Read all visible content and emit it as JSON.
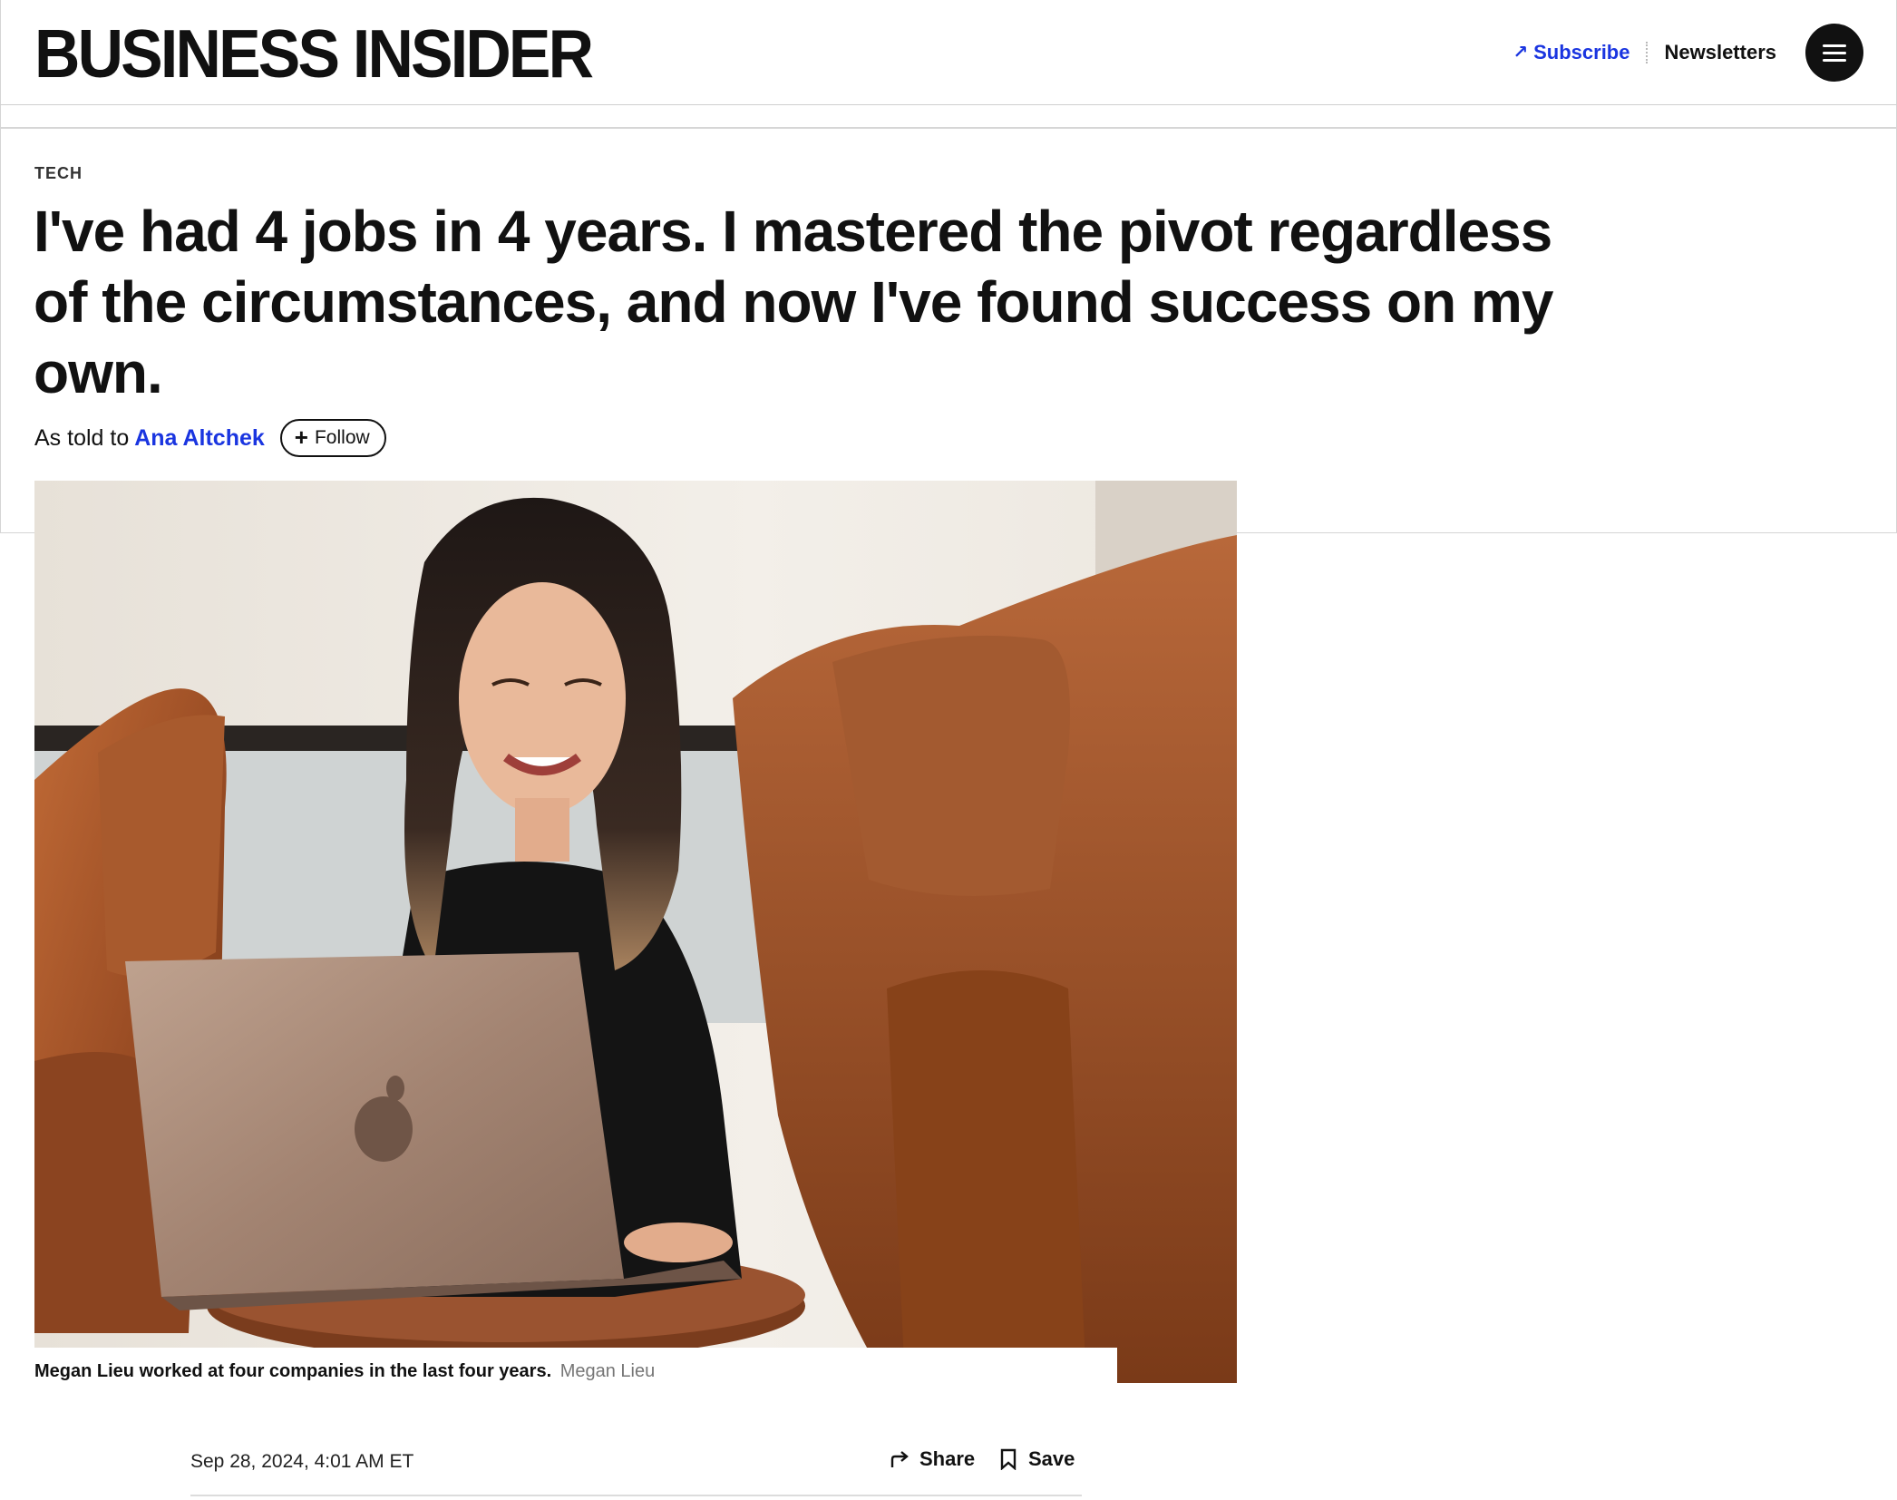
{
  "header": {
    "logo": "BUSINESS INSIDER",
    "subscribe_label": "Subscribe",
    "newsletters_label": "Newsletters",
    "menu_icon": "hamburger-menu-icon",
    "accent_color": "#1a35e0"
  },
  "article": {
    "category": "TECH",
    "headline": "I've had 4 jobs in 4 years. I mastered the pivot regardless of the circumstances, and now I've found success on my own.",
    "byline_prefix": "As told to",
    "author": "Ana Altchek",
    "follow_label": "Follow",
    "hero_image": {
      "caption": "Megan Lieu worked at four companies in the last four years.",
      "credit": "Megan Lieu"
    },
    "date": "Sep 28, 2024, 4:01 AM ET",
    "share_label": "Share",
    "save_label": "Save"
  }
}
